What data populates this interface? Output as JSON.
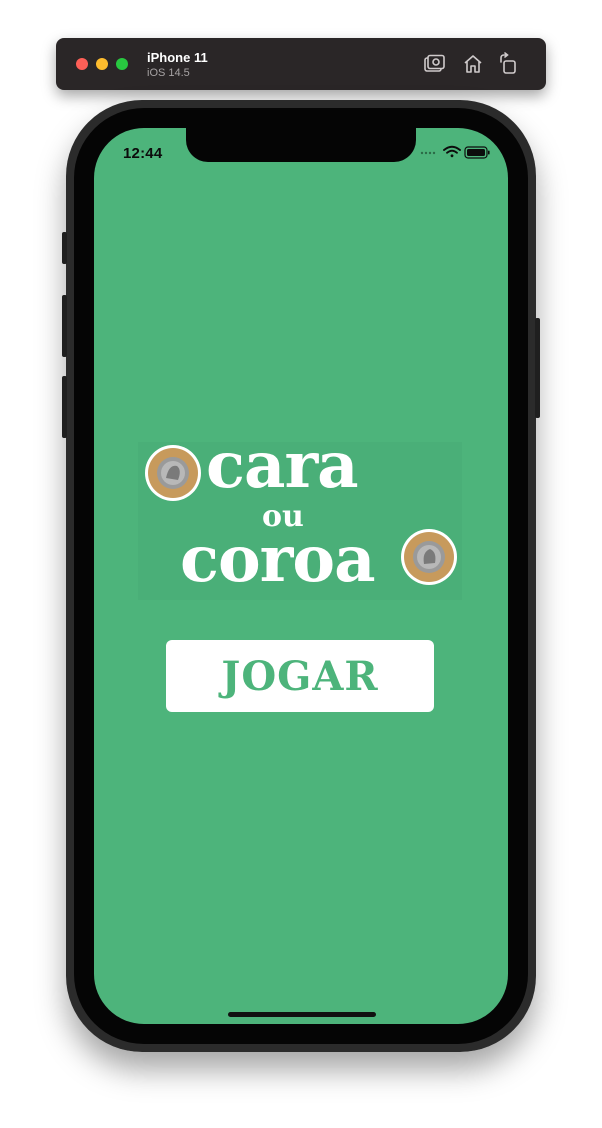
{
  "simulator": {
    "device_name": "iPhone 11",
    "os_version": "iOS 14.5",
    "icons": [
      "screenshot-icon",
      "home-icon",
      "rotate-icon"
    ]
  },
  "status_bar": {
    "time": "12:44",
    "icons": [
      "signal-icon",
      "wifi-icon",
      "battery-icon"
    ]
  },
  "app": {
    "background_color": "#4db47b",
    "logo": {
      "line1": "cara",
      "line2": "ou",
      "line3": "coroa",
      "icons": [
        "coin-icon",
        "coin-icon"
      ]
    },
    "play_button_label": "JOGAR"
  }
}
